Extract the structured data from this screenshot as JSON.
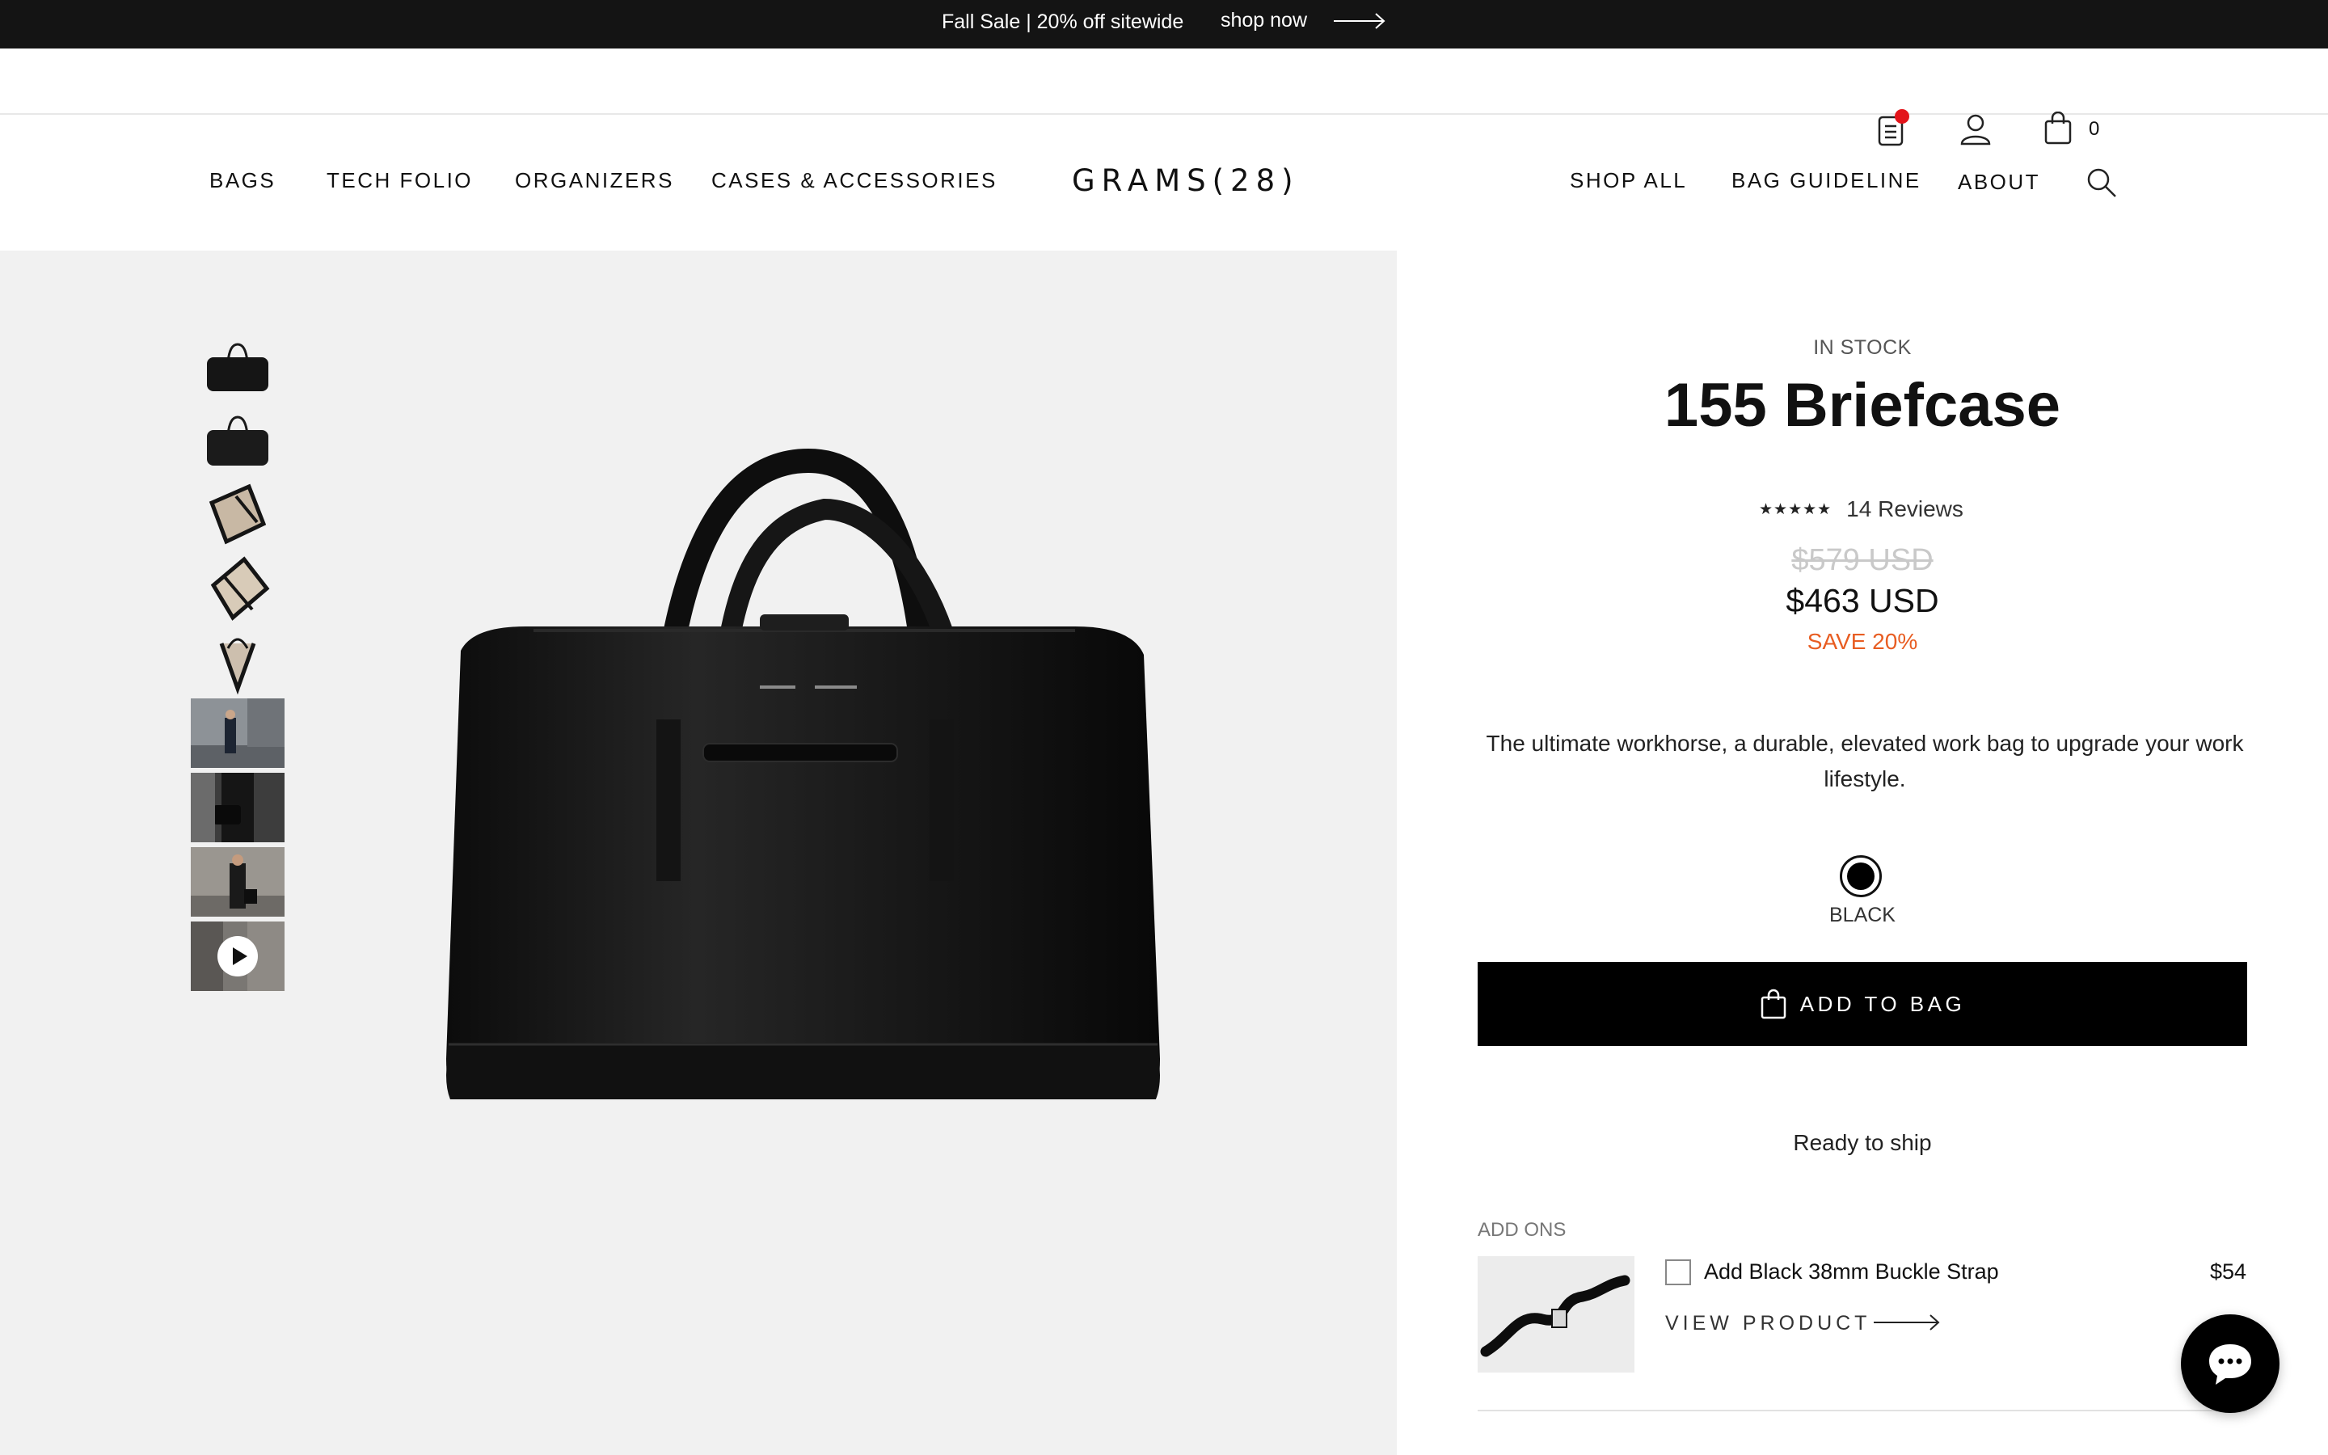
{
  "announcement": {
    "message": "Fall Sale | 20% off sitewide",
    "link_label": "shop now"
  },
  "utility": {
    "icons": [
      "clipboard-list-icon",
      "user-icon",
      "shopping-bag-icon"
    ],
    "cart_count": "0"
  },
  "nav": {
    "left": [
      "BAGS",
      "TECH FOLIO",
      "ORGANIZERS",
      "CASES & ACCESSORIES"
    ],
    "logo": "GRAMS(28)",
    "right": [
      "SHOP ALL",
      "BAG GUIDELINE",
      "ABOUT"
    ]
  },
  "gallery": {
    "thumbnail_count": 9,
    "has_video": true
  },
  "product": {
    "availability": "IN STOCK",
    "title": "155 Briefcase",
    "stars": "★★★★★",
    "rating": 5,
    "reviews": "14 Reviews",
    "original_price": "$579 USD",
    "price": "$463 USD",
    "savings": "SAVE 20%",
    "description": "The ultimate workhorse, a durable, elevated work bag to upgrade your work lifestyle.",
    "color_label": "BLACK",
    "add_to_bag": "ADD TO BAG",
    "shipping": "Ready to ship"
  },
  "addons": {
    "heading": "ADD ONS",
    "items": [
      {
        "name": "Add Black 38mm Buckle Strap",
        "price": "$54",
        "checked": false,
        "view_label": "VIEW PRODUCT"
      }
    ]
  },
  "colors": {
    "announcement_bg": "#141414",
    "save_text": "#e85d22",
    "notification_dot": "#e3141a",
    "gallery_bg": "#f1f1f1",
    "button_bg": "#000000"
  }
}
